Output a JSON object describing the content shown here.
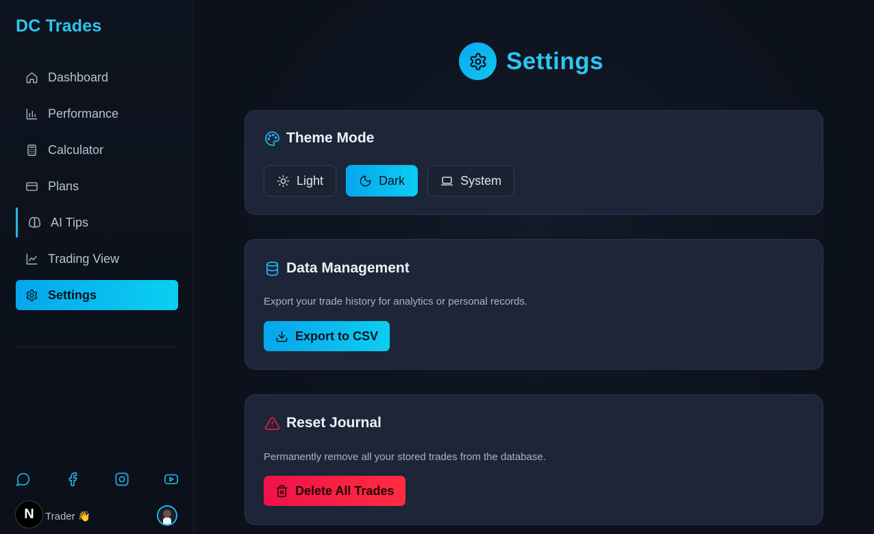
{
  "brand": "DC Trades",
  "nav": [
    {
      "label": "Dashboard",
      "icon": "home-icon"
    },
    {
      "label": "Performance",
      "icon": "bar-chart-icon"
    },
    {
      "label": "Calculator",
      "icon": "calculator-icon"
    },
    {
      "label": "Plans",
      "icon": "credit-card-icon"
    },
    {
      "label": "AI Tips",
      "icon": "brain-icon"
    },
    {
      "label": "Trading View",
      "icon": "line-chart-icon"
    },
    {
      "label": "Settings",
      "icon": "gear-icon",
      "active": true
    }
  ],
  "socials": [
    "chat-icon",
    "facebook-icon",
    "instagram-icon",
    "youtube-icon"
  ],
  "user": {
    "logo_letter": "N",
    "name": "Trader 👋"
  },
  "page": {
    "title": "Settings"
  },
  "theme_card": {
    "title": "Theme Mode",
    "options": [
      {
        "label": "Light",
        "icon": "sun-icon"
      },
      {
        "label": "Dark",
        "icon": "moon-icon",
        "selected": true
      },
      {
        "label": "System",
        "icon": "laptop-icon"
      }
    ]
  },
  "data_card": {
    "title": "Data Management",
    "description": "Export your trade history for analytics or personal records.",
    "button": "Export to CSV"
  },
  "reset_card": {
    "title": "Reset Journal",
    "description": "Permanently remove all your stored trades from the database.",
    "button": "Delete All Trades"
  },
  "colors": {
    "accent": "#0bb8ef",
    "brand_text": "#2ec5f2",
    "danger": "#f0124a",
    "card_bg": "#1d2638",
    "page_bg": "#0c111b"
  }
}
